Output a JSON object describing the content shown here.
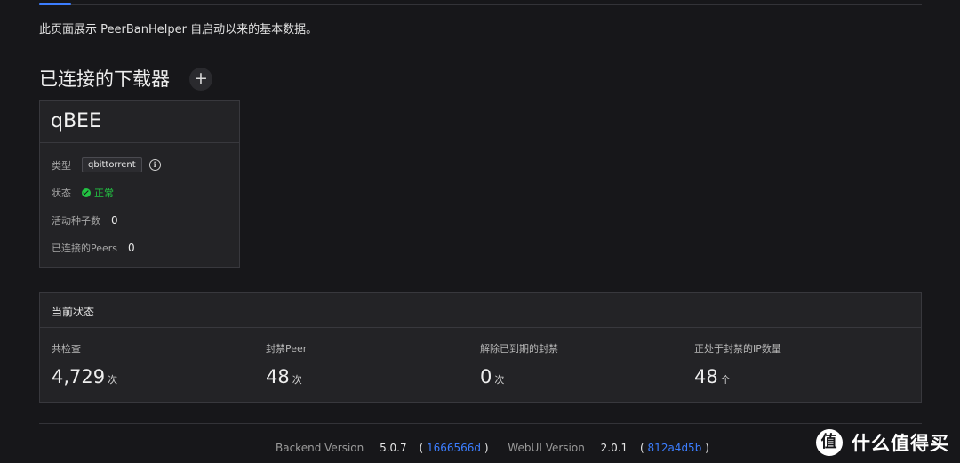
{
  "intro": "此页面展示 PeerBanHelper 自启动以来的基本数据。",
  "downloaders": {
    "title": "已连接的下载器",
    "add_label": "+",
    "card": {
      "name": "qBEE",
      "type_label": "类型",
      "type_value": "qbittorrent",
      "status_label": "状态",
      "status_value": "正常",
      "torrents_label": "活动种子数",
      "torrents_value": "0",
      "peers_label": "已连接的Peers",
      "peers_value": "0"
    }
  },
  "status": {
    "title": "当前状态",
    "items": [
      {
        "label": "共检查",
        "value": "4,729",
        "unit": "次"
      },
      {
        "label": "封禁Peer",
        "value": "48",
        "unit": "次"
      },
      {
        "label": "解除已到期的封禁",
        "value": "0",
        "unit": "次"
      },
      {
        "label": "正处于封禁的IP数量",
        "value": "48",
        "unit": "个"
      }
    ]
  },
  "footer": {
    "backend_label": "Backend Version",
    "backend_version": "5.0.7",
    "backend_hash": "1666566d",
    "webui_label": "WebUI Version",
    "webui_version": "2.0.1",
    "webui_hash": "812a4d5b",
    "open_paren": "(",
    "close_paren": ")"
  },
  "watermark": {
    "icon": "值",
    "text": "什么值得买"
  },
  "colors": {
    "accent": "#3c7eff",
    "success": "#23c343",
    "background": "#17171a",
    "card": "#232326"
  }
}
